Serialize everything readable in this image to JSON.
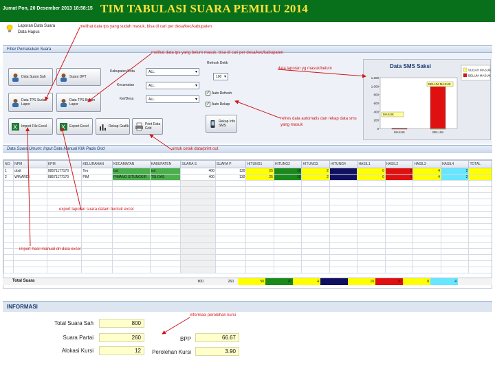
{
  "header": {
    "datetime": "Jumat Pon, 20 Desember 2013 18:58:15",
    "title": "TIM TABULASI SUARA PEMILU 2014"
  },
  "tips": {
    "line1": "Laporan Data Suara",
    "line2": "Data Hapus"
  },
  "filter": {
    "section_title": "Filter Pemasukan Suara",
    "buttons": {
      "data_suara_sah": "Data Suara Sah",
      "suara_dpt": "Suara DPT",
      "data_tps_sudah_lapor": "Data TPS Sudah Lapor",
      "data_tps_belum_lapor": "Data TPS Belum Lapor",
      "import_file_excel": "Import File Excel",
      "export_excel": "Export Excel",
      "rekap_grafik": "Rekap Grafik",
      "print_data_grid": "Print Data Grid",
      "rekap_sms": "Rekap Info SMS"
    },
    "kabupaten_label": "Kabupaten/Kota",
    "kabupaten_value": "ALL",
    "kecamatan_label": "Kecamatan",
    "kecamatan_value": "ALL",
    "kelurahan_label": "Kel/Desa",
    "kelurahan_value": "ALL",
    "refresh_label": "Refresh Detik",
    "refresh_value": "100",
    "auto_refresh_label": "Auto Refresh",
    "auto_rekap_label": "Auto Rekap"
  },
  "chart_data": {
    "type": "bar",
    "title": "Data SMS Saksi",
    "categories": [
      "MASUK",
      "BELUM"
    ],
    "series": [
      {
        "name": "SUDAH MASUK",
        "values": [
          5,
          0
        ],
        "color": "#ffff66"
      },
      {
        "name": "BELUM MASUK",
        "values": [
          0,
          1000
        ],
        "color": "#e01010"
      }
    ],
    "data_labels": [
      "MASUK",
      "BELUM MASUK"
    ],
    "yticks": [
      "1.200",
      "1.000",
      "800",
      "600",
      "400",
      "200",
      "0"
    ],
    "ylim": [
      0,
      1200
    ],
    "legend_position": "top-right"
  },
  "grid": {
    "section_title": "Data Suara Umum: Input Data Manual Klik Pada Grid",
    "columns": [
      "NO",
      "NPM",
      "KPM",
      "KELURAHAN",
      "KECAMATAN",
      "KABUPATEN",
      "SUARA S",
      "SUARA P",
      "HITUNG1",
      "HITUNG2",
      "HITUNG3",
      "HITUNG4",
      "HASIL1",
      "HASIL2",
      "HASIL3",
      "HASIL4",
      "TOTAL"
    ],
    "rows": [
      [
        "1",
        "dodi",
        "08571177170",
        "Tes",
        "tsd",
        "tsd",
        "400",
        "130",
        "25",
        "10",
        "2",
        "",
        "0",
        "5",
        "4",
        "2",
        ""
      ],
      [
        "2",
        "WINARDI",
        "08571177170",
        "PIM",
        "PIMANG SITUNGKIR",
        "TSI-DAS",
        "400",
        "130",
        "25",
        "10",
        "2",
        "",
        "0",
        "5",
        "4",
        "2",
        ""
      ]
    ],
    "total_label": "Total Suara",
    "totals": [
      "800",
      "260",
      "50",
      "20",
      "4",
      "1",
      "10",
      "10",
      "8",
      "4"
    ]
  },
  "info": {
    "section_title": "INFORMASI",
    "total_suara_sah_label": "Total Suara Sah",
    "total_suara_sah": "800",
    "suara_partai_label": "Suara Partai",
    "suara_partai": "260",
    "alokasi_kursi_label": "Alokasi Kursi",
    "alokasi_kursi": "12",
    "bpp_label": "BPP",
    "bpp": "66.67",
    "perolehan_kursi_label": "Perolehan Kursi",
    "perolehan_kursi": "3.90"
  },
  "annotations": {
    "a1": "melihat data tps yang sudah masuk, bisa di cari per desa/kec/kabupaten",
    "a2": "melihat data tps yang belum masuk, bisa di cari per desa/kec/kabupaten",
    "a3": "data laporan yg masuk/belum",
    "a4": "refres data automatis dan rekap data sms yang masuk",
    "a5": "untuk cetak data/print out",
    "a6": "export laporan suara dalam bentuk excel",
    "a7": "import hasil manual dri data excel",
    "a8": "informasi perolehan kursi"
  },
  "colors": {
    "header_bg": "#08701a",
    "title_color": "#ffe23a",
    "annotation": "#d01818"
  }
}
